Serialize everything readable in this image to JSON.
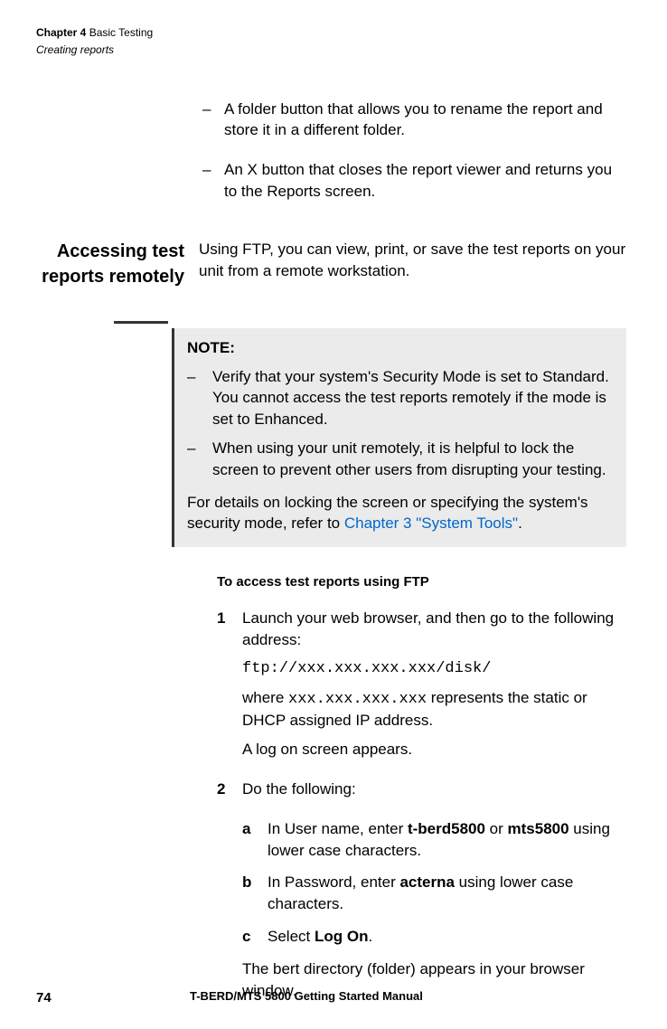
{
  "header": {
    "chapterLabel": "Chapter 4",
    "chapterTitle": "Basic Testing",
    "section": "Creating reports"
  },
  "topBullets": [
    "A folder button that allows you to rename the report and store it in a different folder.",
    "An X button that closes the report viewer and returns you to the Reports screen."
  ],
  "sectionHeading": "Accessing test reports remotely",
  "sectionIntro": "Using FTP, you can view, print, or save the test reports on your unit from a remote workstation.",
  "note": {
    "title": "NOTE:",
    "bullets": [
      "Verify that your system's Security Mode is set to Standard. You cannot access the test reports remotely if the mode is set to Enhanced.",
      "When using your unit remotely, it is helpful to lock the screen to prevent other users from disrupting your testing."
    ],
    "paraPrefix": "For details on locking the screen or specifying the system's security mode, refer to ",
    "link": "Chapter 3 \"System Tools\"",
    "paraSuffix": "."
  },
  "procedure": {
    "title": "To access test reports using FTP",
    "steps": [
      {
        "num": "1",
        "text": "Launch your web browser, and then go to the following address:",
        "code": "ftp://xxx.xxx.xxx.xxx/disk/",
        "afterPrefix": "where ",
        "afterCode": "xxx.xxx.xxx.xxx",
        "afterSuffix": " represents the static or DHCP assigned IP address.",
        "result": "A log on screen appears."
      },
      {
        "num": "2",
        "text": "Do the following:",
        "substeps": [
          {
            "letter": "a",
            "prefix": "In User name, enter ",
            "bold1": "t-berd5800",
            "mid": " or ",
            "bold2": "mts5800",
            "suffix": " using lower case characters."
          },
          {
            "letter": "b",
            "prefix": "In Password, enter ",
            "bold1": "acterna",
            "suffix": " using lower case characters."
          },
          {
            "letter": "c",
            "prefix": "Select ",
            "bold1": "Log On",
            "suffix": "."
          }
        ],
        "substepResult": "The bert directory (folder) appears in your browser window."
      }
    ]
  },
  "footer": {
    "pageNum": "74",
    "title": "T-BERD/MTS 5800 Getting Started Manual"
  }
}
